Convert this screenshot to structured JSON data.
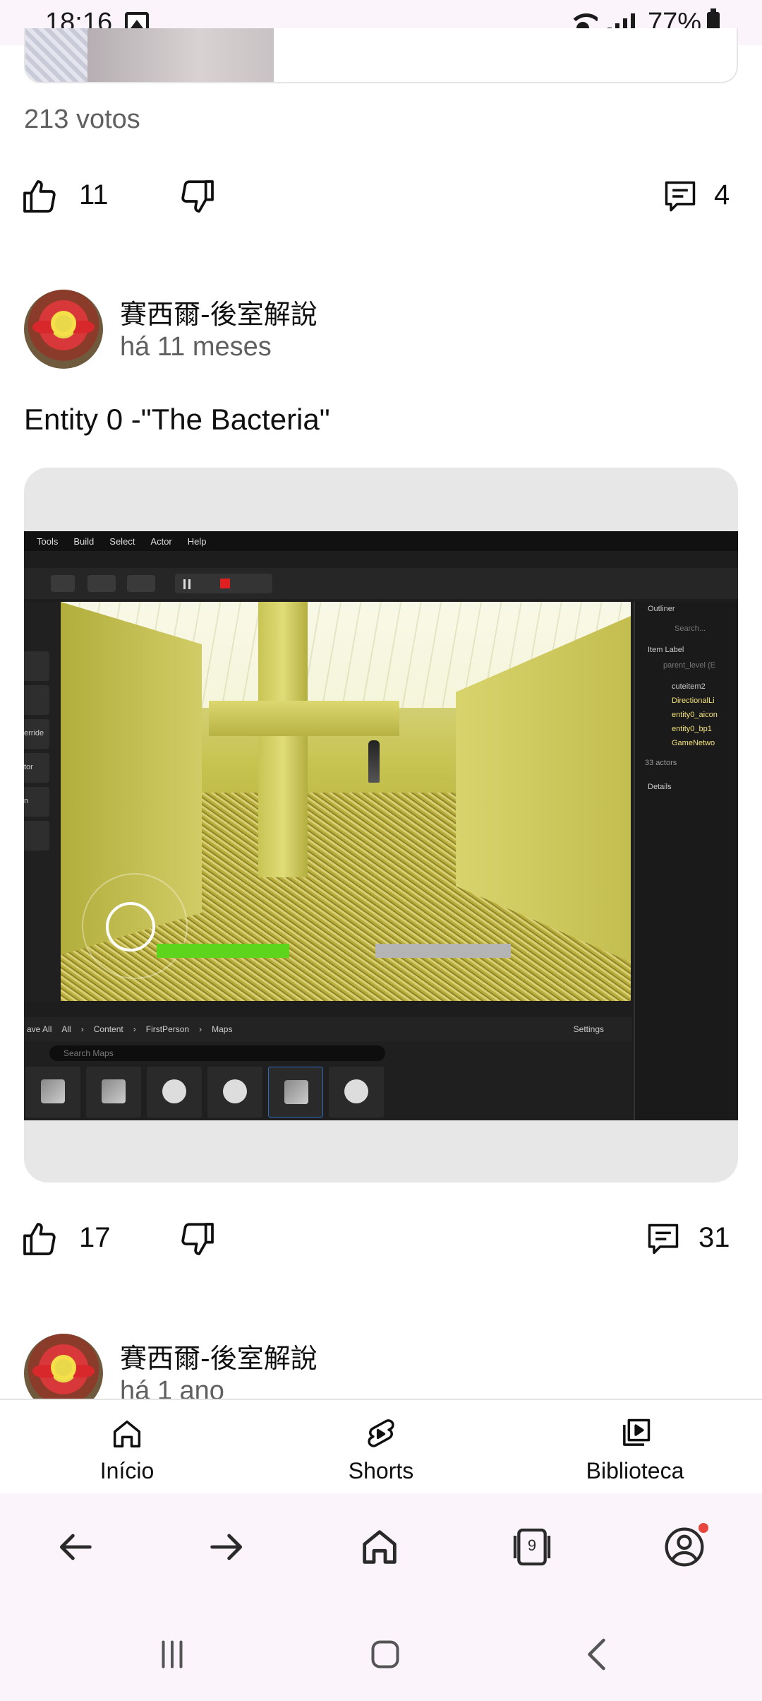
{
  "status_bar": {
    "time": "18:16",
    "battery": "77%"
  },
  "previous_post": {
    "votes": "213 votos",
    "likes": "11",
    "comments": "4"
  },
  "post": {
    "channel": "賽西爾-後室解說",
    "time_ago": "há 11 meses",
    "text": "Entity 0 -\"The Bacteria\"",
    "likes": "17",
    "comments": "31",
    "image": {
      "menu": [
        "Tools",
        "Build",
        "Select",
        "Actor",
        "Help"
      ],
      "left_panel_labels": [
        "erride",
        "tor",
        "n"
      ],
      "outliner": {
        "title": "Outliner",
        "search_placeholder": "Search...",
        "column": "Item Label",
        "items": [
          "parent_level (E",
          "cuteitem",
          "cuteitem2",
          "DirectionalLi",
          "entity0_aicon",
          "entity0_bp1",
          "GameNetwo"
        ],
        "count": "33 actors"
      },
      "details_title": "Details",
      "breadcrumb": [
        "ave All",
        "All",
        "Content",
        "FirstPerson",
        "Maps"
      ],
      "settings_label": "Settings",
      "search_maps_placeholder": "Search Maps"
    }
  },
  "next_post": {
    "channel": "賽西爾-後室解說",
    "time_ago": "há 1 ano"
  },
  "yt_nav": {
    "home": "Início",
    "shorts": "Shorts",
    "library": "Biblioteca"
  },
  "browser": {
    "tab_count": "9"
  },
  "colors": {
    "accent_red": "#e8453c",
    "text_secondary": "#606060"
  }
}
